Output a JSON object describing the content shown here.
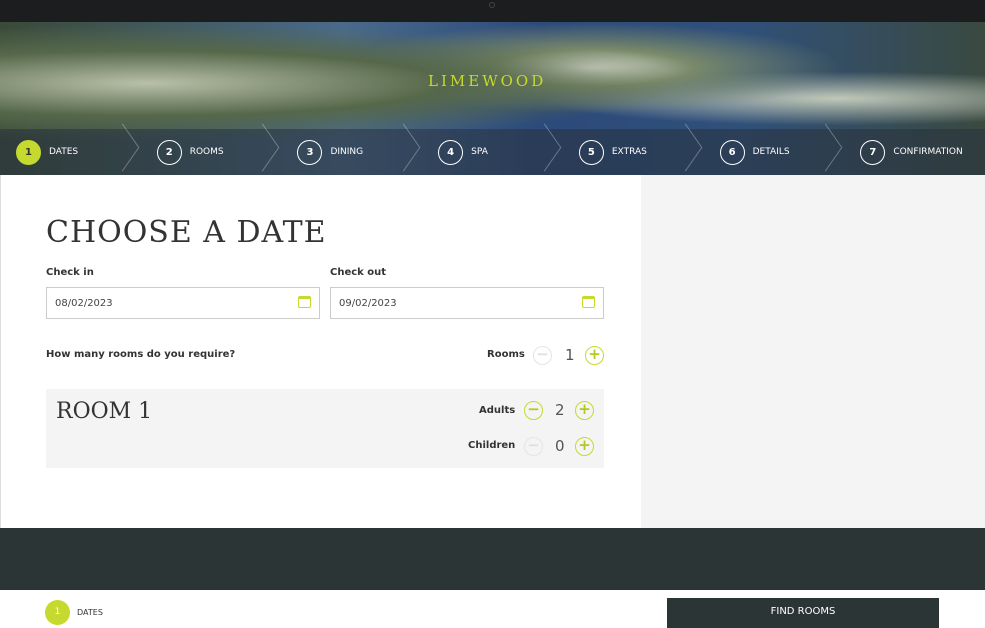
{
  "brand": {
    "logo": "LIMEWOOD"
  },
  "steps": [
    {
      "n": "1",
      "label": "DATES"
    },
    {
      "n": "2",
      "label": "ROOMS"
    },
    {
      "n": "3",
      "label": "DINING"
    },
    {
      "n": "4",
      "label": "SPA"
    },
    {
      "n": "5",
      "label": "EXTRAS"
    },
    {
      "n": "6",
      "label": "DETAILS"
    },
    {
      "n": "7",
      "label": "CONFIRMATION"
    }
  ],
  "page": {
    "title": "CHOOSE A DATE",
    "checkin_label": "Check in",
    "checkin_value": "08/02/2023",
    "checkout_label": "Check out",
    "checkout_value": "09/02/2023",
    "rooms_question": "How many rooms do you require?",
    "rooms_label": "Rooms",
    "rooms_value": "1"
  },
  "room": {
    "title": "ROOM 1",
    "adults_label": "Adults",
    "adults_value": "2",
    "children_label": "Children",
    "children_value": "0"
  },
  "sticky": {
    "step_n": "1",
    "step_label": "DATES",
    "find_button": "FIND ROOMS"
  },
  "colors": {
    "accent": "#c6d92e",
    "dark": "#2c3535"
  }
}
